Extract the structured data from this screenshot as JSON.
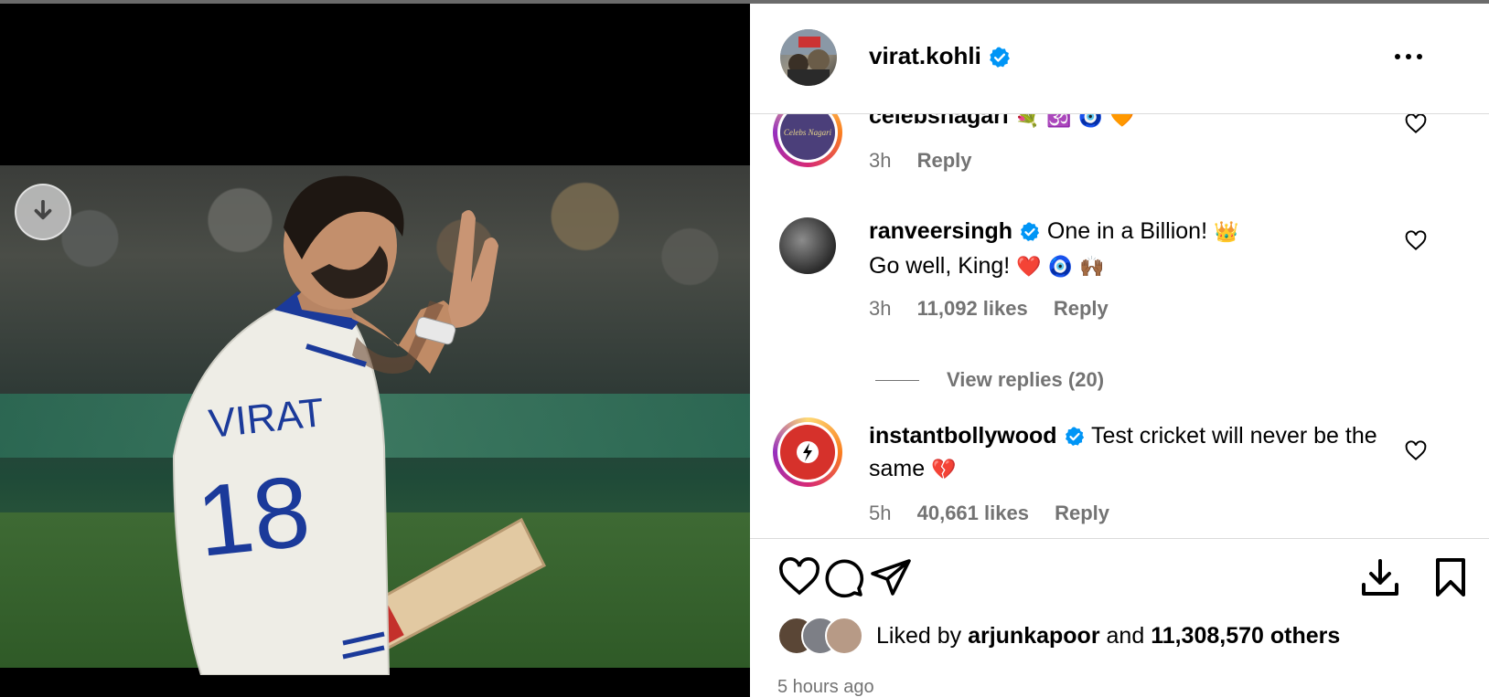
{
  "post": {
    "username": "virat.kohli",
    "verified": true
  },
  "comments": [
    {
      "username": "celebsnagari",
      "text": "",
      "emojis": "💐 🕉️ 🧿 🧡",
      "avatar_label": "Celebs Nagari",
      "time": "3h",
      "likes": "",
      "reply_label": "Reply"
    },
    {
      "username": "ranveersingh",
      "verified": true,
      "text": "One in a Billion!",
      "emoji_after_text": "👑",
      "text_line2": "Go well, King!",
      "emojis_line2": "❤️ 🧿 🙌🏾",
      "time": "3h",
      "likes": "11,092 likes",
      "reply_label": "Reply"
    },
    {
      "username": "instantbollywood",
      "verified": true,
      "text": "Test cricket will never be the same",
      "emojis": "💔",
      "avatar_label": "Instant Bollywood",
      "time": "5h",
      "likes": "40,661 likes",
      "reply_label": "Reply"
    }
  ],
  "view_replies": "View replies (20)",
  "liked_by": {
    "prefix": "Liked by",
    "user": "arjunkapoor",
    "conjunction": "and",
    "others": "11,308,570 others"
  },
  "timestamp": "5 hours ago",
  "jersey": {
    "name": "VIRAT",
    "number": "18"
  },
  "colors": {
    "verified_blue": "#0095f6",
    "muted_text": "#737373",
    "heart_pink": "#ed4956"
  },
  "icons": [
    "download-icon",
    "more-icon",
    "heart-icon",
    "comment-icon",
    "share-icon",
    "save-icon",
    "bookmark-icon",
    "verified-icon"
  ]
}
